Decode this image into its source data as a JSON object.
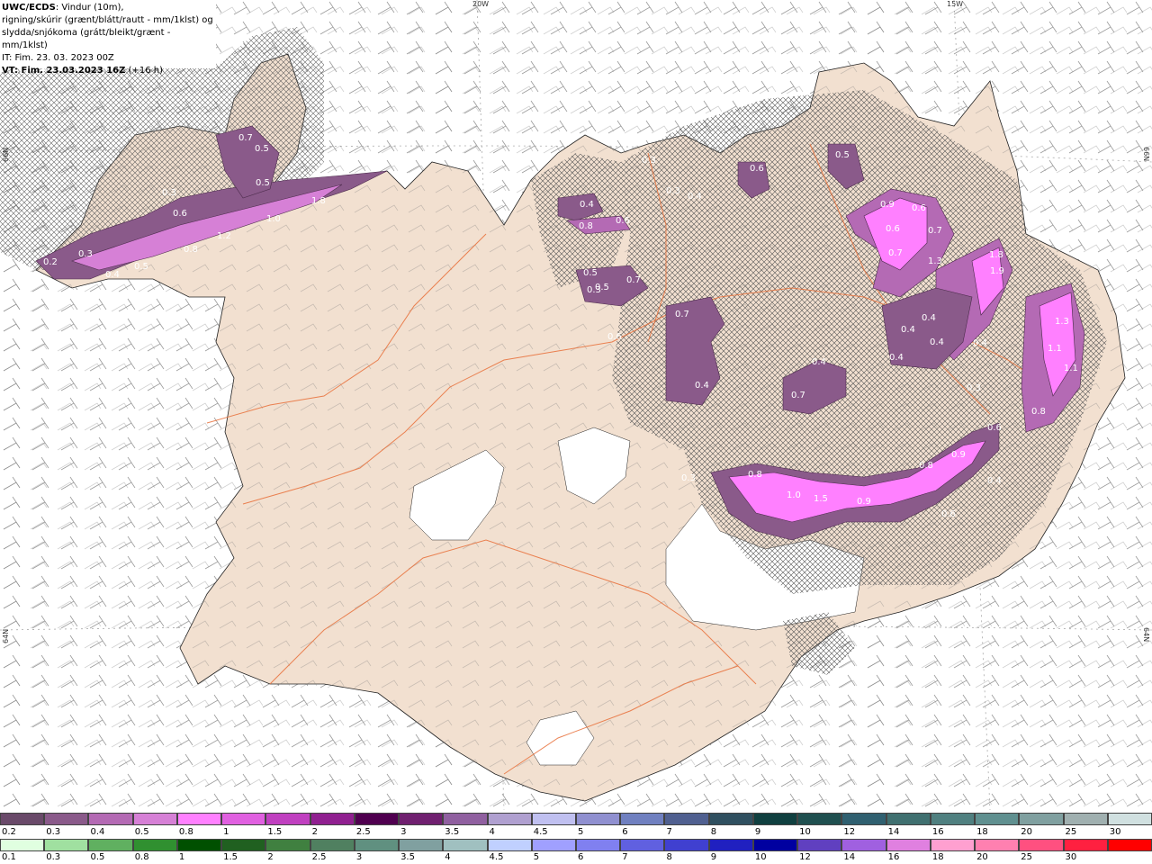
{
  "header": {
    "title_bold": "UWC/ECDS",
    "title_rest": ": Vindur (10m),",
    "line2": "rigning/skúrir (grænt/blátt/rautt - mm/1klst) og",
    "line3": "slydda/snjókoma (grátt/bleikt/grænt - mm/1klst)",
    "line4": "IT: Fim. 23. 03. 2023 00Z",
    "line5_bold": "VT: Fim. 23.03.2023 16Z",
    "line5_rest": " (+16 h)"
  },
  "coords": {
    "lon_20w": "20W",
    "lon_15w": "15W",
    "lat_66n_left": "66N",
    "lat_66n_right": "66N",
    "lat_64n_left": "64N",
    "lat_64n_right": "64N"
  },
  "precip_labels": [
    {
      "id": "p1",
      "text": "0.7"
    },
    {
      "id": "p2",
      "text": "0.5"
    },
    {
      "id": "p3",
      "text": "0.5"
    },
    {
      "id": "p4",
      "text": "1.8"
    },
    {
      "id": "p5",
      "text": "0.3"
    },
    {
      "id": "p6",
      "text": "0.6"
    },
    {
      "id": "p7",
      "text": "1.0"
    },
    {
      "id": "p8",
      "text": "1.2"
    },
    {
      "id": "p9",
      "text": "0.8"
    },
    {
      "id": "p10",
      "text": "0.5"
    },
    {
      "id": "p11",
      "text": "0.4"
    },
    {
      "id": "p12",
      "text": "0.3"
    },
    {
      "id": "p13",
      "text": "0.2"
    },
    {
      "id": "p14",
      "text": "0.4"
    },
    {
      "id": "p15",
      "text": "0.6"
    },
    {
      "id": "p16",
      "text": "0.8"
    },
    {
      "id": "p17",
      "text": "0.3"
    },
    {
      "id": "p18",
      "text": "0.3"
    },
    {
      "id": "p19",
      "text": "0.4"
    },
    {
      "id": "p20",
      "text": "0.6"
    },
    {
      "id": "p21",
      "text": "0.5"
    },
    {
      "id": "p22",
      "text": "0.3"
    },
    {
      "id": "p23",
      "text": "0.5"
    },
    {
      "id": "p24",
      "text": "0.6"
    },
    {
      "id": "p25",
      "text": "0.7"
    },
    {
      "id": "p26",
      "text": "0.5"
    },
    {
      "id": "p27",
      "text": "0.7"
    },
    {
      "id": "p28",
      "text": "0.4"
    },
    {
      "id": "p29",
      "text": "0.9"
    },
    {
      "id": "p30",
      "text": "0.6"
    },
    {
      "id": "p31",
      "text": "0.6"
    },
    {
      "id": "p32",
      "text": "0.7"
    },
    {
      "id": "p33",
      "text": "0.7"
    },
    {
      "id": "p34",
      "text": "1.3"
    },
    {
      "id": "p35",
      "text": "1.8"
    },
    {
      "id": "p36",
      "text": "1.9"
    },
    {
      "id": "p37",
      "text": "0.4"
    },
    {
      "id": "p38",
      "text": "0.4"
    },
    {
      "id": "p39",
      "text": "0.4"
    },
    {
      "id": "p40",
      "text": "0.4"
    },
    {
      "id": "p41",
      "text": "0.4"
    },
    {
      "id": "p42",
      "text": "0.4"
    },
    {
      "id": "p43",
      "text": "0.7"
    },
    {
      "id": "p44",
      "text": "0.3"
    },
    {
      "id": "p45",
      "text": "1.3"
    },
    {
      "id": "p46",
      "text": "1.1"
    },
    {
      "id": "p47",
      "text": "1.1"
    },
    {
      "id": "p48",
      "text": "0.8"
    },
    {
      "id": "p49",
      "text": "0.6"
    },
    {
      "id": "p50",
      "text": "0.9"
    },
    {
      "id": "p51",
      "text": "0.8"
    },
    {
      "id": "p52",
      "text": "0.4"
    },
    {
      "id": "p53",
      "text": "0.3"
    },
    {
      "id": "p54",
      "text": "1.0"
    },
    {
      "id": "p55",
      "text": "1.5"
    },
    {
      "id": "p56",
      "text": "0.9"
    },
    {
      "id": "p57",
      "text": "0.8"
    },
    {
      "id": "p58",
      "text": "0.6"
    }
  ],
  "legend_snow": {
    "labels": [
      "0.2",
      "0.3",
      "0.4",
      "0.5",
      "0.8",
      "1",
      "1.5",
      "2",
      "2.5",
      "3",
      "3.5",
      "4",
      "4.5",
      "5",
      "6",
      "7",
      "8",
      "9",
      "10",
      "12",
      "14",
      "16",
      "18",
      "20",
      "25",
      "30"
    ],
    "colors": [
      "#6a4a6a",
      "#8a5a8a",
      "#b46ab4",
      "#d680d6",
      "#ff80ff",
      "#e060e0",
      "#c040c0",
      "#902090",
      "#500050",
      "#702070",
      "#9060a0",
      "#b0a0d0",
      "#c0c0f0",
      "#9090d0",
      "#7080c0",
      "#506090",
      "#305060",
      "#104040",
      "#205050",
      "#306070",
      "#407070",
      "#508080",
      "#609090",
      "#80a0a0",
      "#a0b0b0",
      "#d0e0e0"
    ]
  },
  "legend_rain": {
    "labels": [
      "0.1",
      "0.3",
      "0.5",
      "0.8",
      "1",
      "1.5",
      "2",
      "2.5",
      "3",
      "3.5",
      "4",
      "4.5",
      "5",
      "6",
      "7",
      "8",
      "9",
      "10",
      "12",
      "14",
      "16",
      "18",
      "20",
      "25",
      "30"
    ],
    "colors": [
      "#e0ffe0",
      "#a0e0a0",
      "#60b060",
      "#309030",
      "#005000",
      "#206020",
      "#408040",
      "#508060",
      "#609080",
      "#80a0a0",
      "#a0c0c0",
      "#c0d0ff",
      "#a0a0ff",
      "#8080f0",
      "#6060e0",
      "#4040d0",
      "#2020c0",
      "#0000a0",
      "#6040c0",
      "#a060e0",
      "#e080e0",
      "#ffa0d0",
      "#ff80b0",
      "#ff5080",
      "#ff2040",
      "#ff0000"
    ]
  }
}
